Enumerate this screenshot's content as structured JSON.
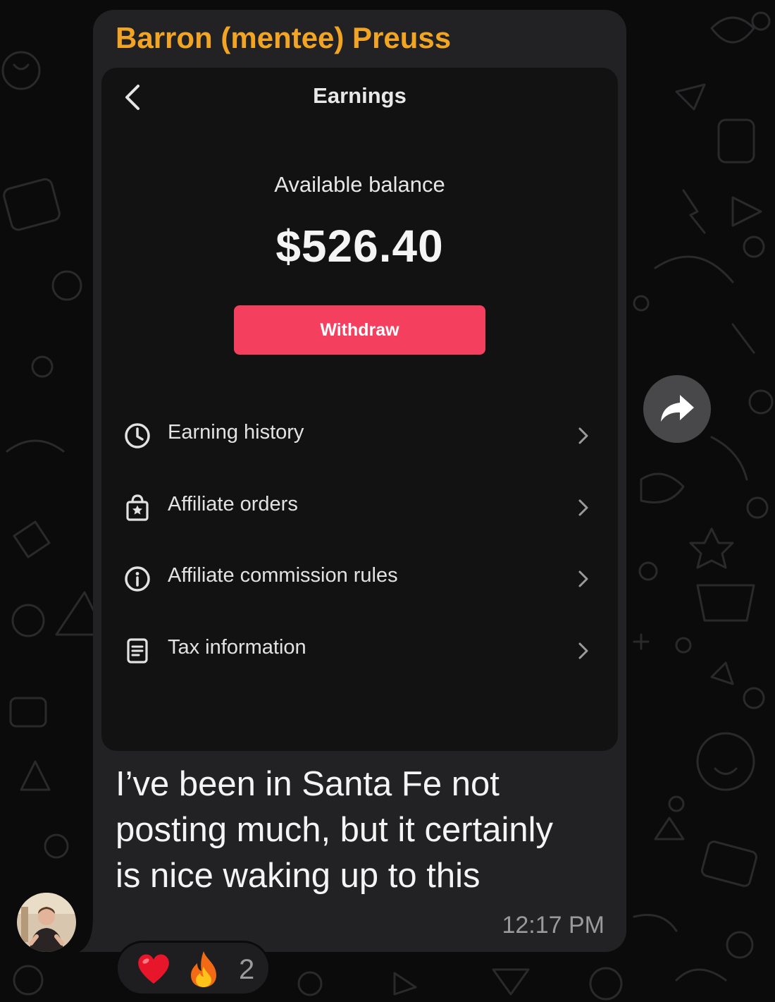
{
  "chat": {
    "sender_name": "Barron (mentee) Preuss",
    "message_lines": [
      "I’ve been in Santa Fe not",
      "posting much, but it certainly",
      "is nice waking up to this"
    ],
    "timestamp": "12:17 PM",
    "reactions": {
      "emojis": [
        "heart",
        "fire"
      ],
      "count": "2"
    },
    "accent_color": "#f2a524"
  },
  "screenshot": {
    "title": "Earnings",
    "balance_label": "Available balance",
    "balance_amount": "$526.40",
    "withdraw_label": "Withdraw",
    "button_color": "#f43f5e",
    "menu": [
      {
        "label": "Earning history",
        "icon": "clock-icon"
      },
      {
        "label": "Affiliate orders",
        "icon": "shopping-bag-icon"
      },
      {
        "label": "Affiliate commission rules",
        "icon": "info-icon"
      },
      {
        "label": "Tax information",
        "icon": "document-icon"
      }
    ]
  }
}
